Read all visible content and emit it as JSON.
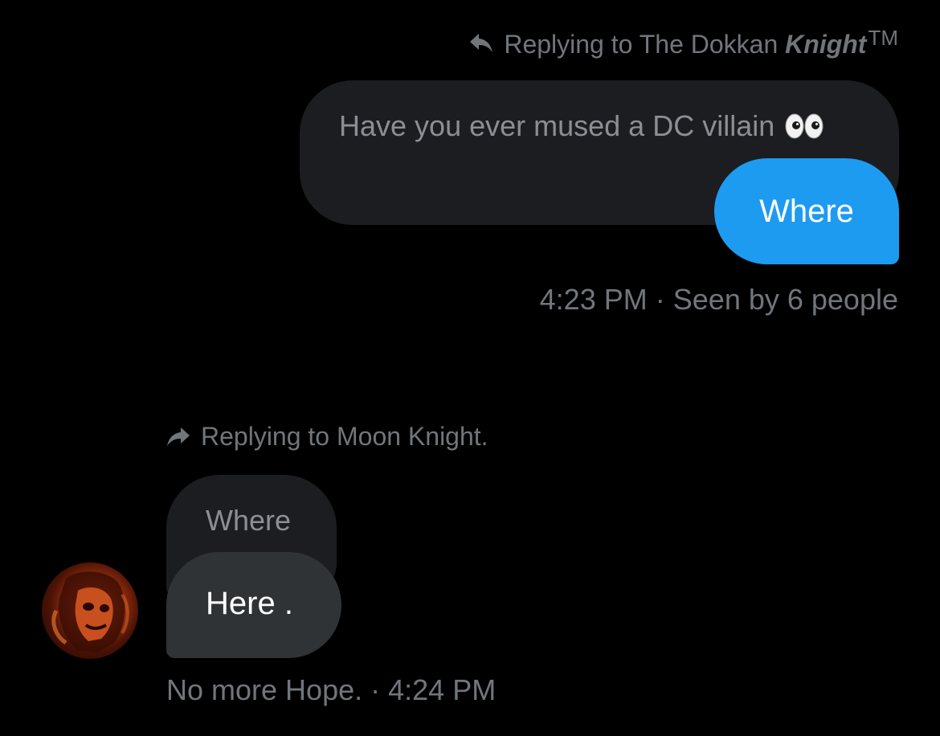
{
  "outgoing": {
    "reply_prefix": "Replying to The Dokkan ",
    "reply_name_bold": "Knight",
    "reply_name_tm": "TM",
    "quoted_text": "Have you ever mused a DC villain",
    "quoted_emoji": "eyes-emoji",
    "message": "Where",
    "time": "4:23 PM",
    "separator": "·",
    "seen_text": "Seen by 6 people"
  },
  "incoming": {
    "reply_text": "Replying to Moon Knight.",
    "quoted_text": "Where",
    "message": "Here .",
    "sender_name": "No more Hope.",
    "separator": "·",
    "time": "4:24 PM",
    "avatar": "avatar-image"
  },
  "colors": {
    "background": "#000000",
    "accent_blue": "#1d9bf0",
    "incoming_bubble": "#2f3336",
    "quoted_bubble": "#1c1d20",
    "muted_text": "#71767b"
  },
  "icons": {
    "reply_right": "reply-arrow-icon",
    "reply_left": "forward-arrow-icon"
  }
}
